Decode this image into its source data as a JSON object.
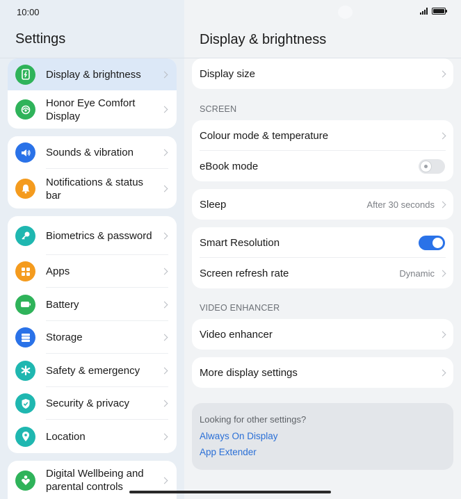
{
  "status": {
    "time": "10:00"
  },
  "left": {
    "title": "Settings",
    "groups": [
      [
        {
          "label": "Display & brightness",
          "icon": "display-brightness-icon",
          "color": "#2fb35a",
          "selected": true
        },
        {
          "label": "Honor Eye Comfort Display",
          "icon": "eye-comfort-icon",
          "color": "#2fb35a"
        }
      ],
      [
        {
          "label": "Sounds & vibration",
          "icon": "speaker-icon",
          "color": "#2a72e8"
        },
        {
          "label": "Notifications & status bar",
          "icon": "bell-icon",
          "color": "#f49b1e"
        }
      ],
      [
        {
          "label": "Biometrics & password",
          "icon": "key-icon",
          "color": "#1fb7b0"
        },
        {
          "label": "Apps",
          "icon": "apps-grid-icon",
          "color": "#f49b1e"
        },
        {
          "label": "Battery",
          "icon": "battery-icon",
          "color": "#2fb35a"
        },
        {
          "label": "Storage",
          "icon": "storage-icon",
          "color": "#2a72e8"
        },
        {
          "label": "Safety & emergency",
          "icon": "asterisk-icon",
          "color": "#1fb7b0"
        },
        {
          "label": "Security & privacy",
          "icon": "shield-check-icon",
          "color": "#1fb7b0"
        },
        {
          "label": "Location",
          "icon": "location-pin-icon",
          "color": "#1fb7b0"
        }
      ],
      [
        {
          "label": "Digital Wellbeing and parental controls",
          "icon": "wellbeing-icon",
          "color": "#2fb35a"
        }
      ]
    ]
  },
  "right": {
    "title": "Display & brightness",
    "display_size": "Display size",
    "section_screen": "SCREEN",
    "colour_mode": "Colour mode & temperature",
    "ebook_mode": "eBook mode",
    "ebook_on": false,
    "sleep": "Sleep",
    "sleep_value": "After 30 seconds",
    "smart_resolution": "Smart Resolution",
    "smart_resolution_on": true,
    "refresh_rate": "Screen refresh rate",
    "refresh_value": "Dynamic",
    "section_video": "VIDEO ENHANCER",
    "video_enhancer": "Video enhancer",
    "more_display": "More display settings",
    "suggest_question": "Looking for other settings?",
    "suggest_links": [
      "Always On Display",
      "App Extender"
    ]
  }
}
